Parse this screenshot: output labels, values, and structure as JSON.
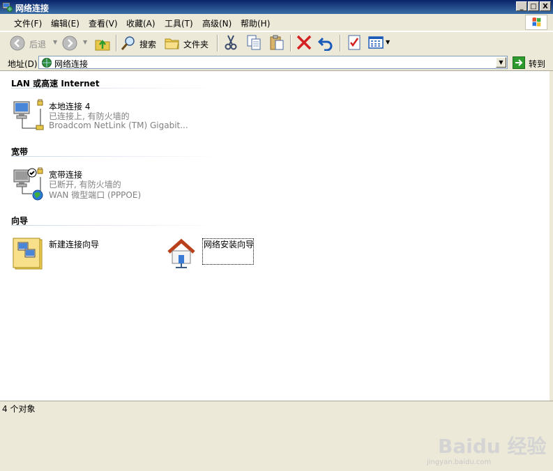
{
  "window": {
    "title": "网络连接",
    "controls": [
      "_",
      "□",
      "X"
    ]
  },
  "menu": [
    "文件(F)",
    "编辑(E)",
    "查看(V)",
    "收藏(A)",
    "工具(T)",
    "高级(N)",
    "帮助(H)"
  ],
  "toolbar": {
    "back_label": "后退",
    "search_label": "搜索",
    "folders_label": "文件夹"
  },
  "address": {
    "label": "地址(D)",
    "value": "网络连接",
    "go_label": "转到"
  },
  "groups": [
    {
      "title": "LAN 或高速 Internet",
      "items": [
        {
          "name": "本地连接 4",
          "status": "已连接上, 有防火墙的",
          "device": "Broadcom NetLink (TM) Gigabit..."
        }
      ]
    },
    {
      "title": "宽带",
      "items": [
        {
          "name": "宽带连接",
          "status": "已断开, 有防火墙的",
          "device": "WAN 微型端口 (PPPOE)"
        }
      ]
    },
    {
      "title": "向导",
      "items": [
        {
          "name": "新建连接向导"
        },
        {
          "name": "网络安装向导"
        }
      ]
    }
  ],
  "status": {
    "text": "4 个对象"
  },
  "watermark": {
    "main": "Baidu 经验",
    "url": "jingyan.baidu.com"
  },
  "colors": {
    "title_bar": "#0a246a",
    "chrome": "#ece9d8",
    "secondary_text": "#808080",
    "delete_red": "#d42020",
    "go_green": "#2e9b2e"
  }
}
